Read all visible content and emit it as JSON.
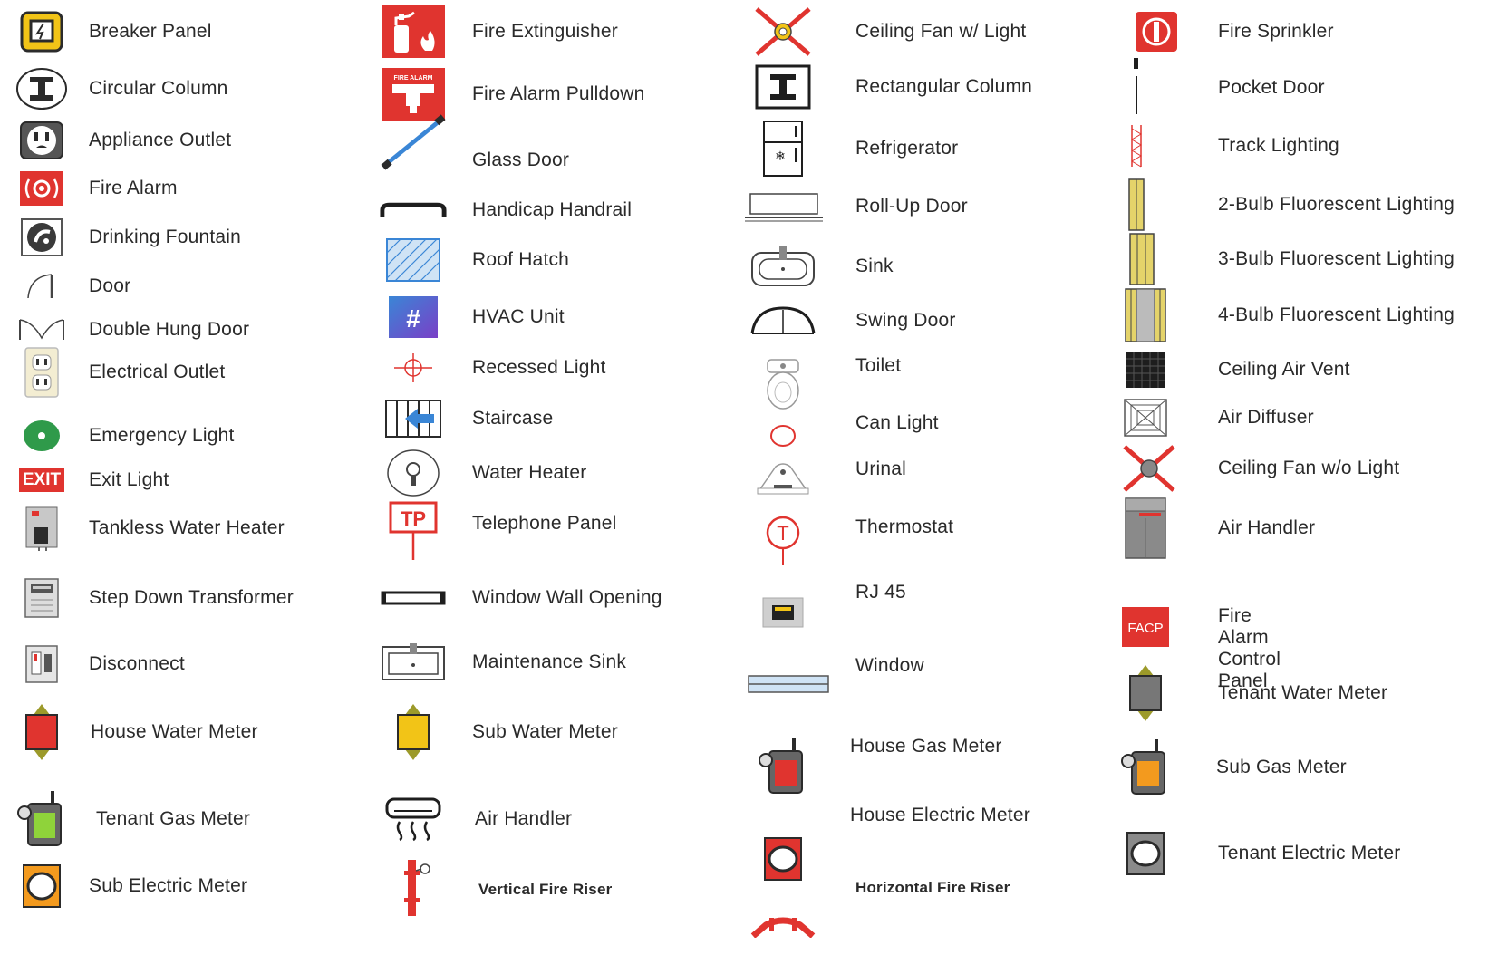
{
  "colors": {
    "fire_red": "#e0342f",
    "yellow": "#f2c417",
    "olive": "#9c9a2a",
    "green": "#2f9a4a",
    "lime": "#8fd33a",
    "orange": "#f39a1e",
    "blue": "#3a86d6",
    "purple": "#5b47c9",
    "gray": "#8a8a8a",
    "dark": "#2b2b2b"
  },
  "legend": {
    "col1": [
      {
        "label": "Breaker Panel",
        "icon": "breaker-panel-icon"
      },
      {
        "label": "Circular Column",
        "icon": "circular-column-icon"
      },
      {
        "label": "Appliance Outlet",
        "icon": "appliance-outlet-icon"
      },
      {
        "label": "Fire Alarm",
        "icon": "fire-alarm-icon"
      },
      {
        "label": "Drinking Fountain",
        "icon": "drinking-fountain-icon"
      },
      {
        "label": "Door",
        "icon": "door-icon"
      },
      {
        "label": "Double Hung Door",
        "icon": "double-hung-door-icon"
      },
      {
        "label": "Electrical Outlet",
        "icon": "electrical-outlet-icon"
      },
      {
        "label": "Emergency Light",
        "icon": "emergency-light-icon"
      },
      {
        "label": "Exit Light",
        "icon": "exit-light-icon",
        "text": "EXIT"
      },
      {
        "label": "Tankless Water Heater",
        "icon": "tankless-water-heater-icon"
      },
      {
        "label": "Step Down Transformer",
        "icon": "step-down-transformer-icon"
      },
      {
        "label": "Disconnect",
        "icon": "disconnect-icon"
      },
      {
        "label": "House Water Meter",
        "icon": "house-water-meter-icon"
      },
      {
        "label": "Tenant Gas Meter",
        "icon": "tenant-gas-meter-icon"
      },
      {
        "label": "Sub Electric Meter",
        "icon": "sub-electric-meter-icon"
      }
    ],
    "col2": [
      {
        "label": "Fire Extinguisher",
        "icon": "fire-extinguisher-icon"
      },
      {
        "label": "Fire Alarm Pulldown",
        "icon": "fire-alarm-pulldown-icon",
        "text": "FIRE ALARM"
      },
      {
        "label": "Glass Door",
        "icon": "glass-door-icon"
      },
      {
        "label": "Handicap Handrail",
        "icon": "handicap-handrail-icon"
      },
      {
        "label": "Roof Hatch",
        "icon": "roof-hatch-icon"
      },
      {
        "label": "HVAC Unit",
        "icon": "hvac-unit-icon",
        "text": "#"
      },
      {
        "label": "Recessed Light",
        "icon": "recessed-light-icon"
      },
      {
        "label": "Staircase",
        "icon": "staircase-icon"
      },
      {
        "label": "Water Heater",
        "icon": "water-heater-icon"
      },
      {
        "label": "Telephone Panel",
        "icon": "telephone-panel-icon",
        "text": "TP"
      },
      {
        "label": "Window Wall Opening",
        "icon": "window-wall-opening-icon"
      },
      {
        "label": "Maintenance Sink",
        "icon": "maintenance-sink-icon"
      },
      {
        "label": "Sub Water Meter",
        "icon": "sub-water-meter-icon"
      },
      {
        "label": "Air Handler",
        "icon": "air-handler-unit-icon"
      },
      {
        "label": "Vertical Fire Riser",
        "icon": "vertical-fire-riser-icon"
      }
    ],
    "col3": [
      {
        "label": "Ceiling Fan w/ Light",
        "icon": "ceiling-fan-light-icon"
      },
      {
        "label": "Rectangular Column",
        "icon": "rectangular-column-icon"
      },
      {
        "label": "Refrigerator",
        "icon": "refrigerator-icon"
      },
      {
        "label": "Roll-Up Door",
        "icon": "roll-up-door-icon"
      },
      {
        "label": "Sink",
        "icon": "sink-icon"
      },
      {
        "label": "Swing Door",
        "icon": "swing-door-icon"
      },
      {
        "label": "Toilet",
        "icon": "toilet-icon"
      },
      {
        "label": "Can Light",
        "icon": "can-light-icon"
      },
      {
        "label": "Urinal",
        "icon": "urinal-icon"
      },
      {
        "label": "Thermostat",
        "icon": "thermostat-icon",
        "text": "T"
      },
      {
        "label": "RJ 45",
        "icon": "rj45-icon"
      },
      {
        "label": "Window",
        "icon": "window-icon"
      },
      {
        "label": "House Gas Meter",
        "icon": "house-gas-meter-icon"
      },
      {
        "label": "House Electric Meter",
        "icon": "house-electric-meter-icon"
      },
      {
        "label": "Horizontal Fire Riser",
        "icon": "horizontal-fire-riser-icon"
      }
    ],
    "col4": [
      {
        "label": "Fire Sprinkler",
        "icon": "fire-sprinkler-icon"
      },
      {
        "label": "Pocket Door",
        "icon": "pocket-door-icon"
      },
      {
        "label": "Track Lighting",
        "icon": "track-lighting-icon"
      },
      {
        "label": "2-Bulb Fluorescent Lighting",
        "icon": "two-bulb-fluorescent-icon"
      },
      {
        "label": "3-Bulb Fluorescent Lighting",
        "icon": "three-bulb-fluorescent-icon"
      },
      {
        "label": "4-Bulb Fluorescent Lighting",
        "icon": "four-bulb-fluorescent-icon"
      },
      {
        "label": "Ceiling Air Vent",
        "icon": "ceiling-air-vent-icon"
      },
      {
        "label": "Air Diffuser",
        "icon": "air-diffuser-icon"
      },
      {
        "label": "Ceiling Fan w/o Light",
        "icon": "ceiling-fan-no-light-icon"
      },
      {
        "label": "Air Handler",
        "icon": "air-handler-icon"
      },
      {
        "label": "Fire Alarm\nControl Panel",
        "icon": "fire-alarm-control-panel-icon",
        "text": "FACP"
      },
      {
        "label": "Tenant Water Meter",
        "icon": "tenant-water-meter-icon"
      },
      {
        "label": "Sub Gas Meter",
        "icon": "sub-gas-meter-icon"
      },
      {
        "label": "Tenant Electric Meter",
        "icon": "tenant-electric-meter-icon"
      }
    ]
  }
}
